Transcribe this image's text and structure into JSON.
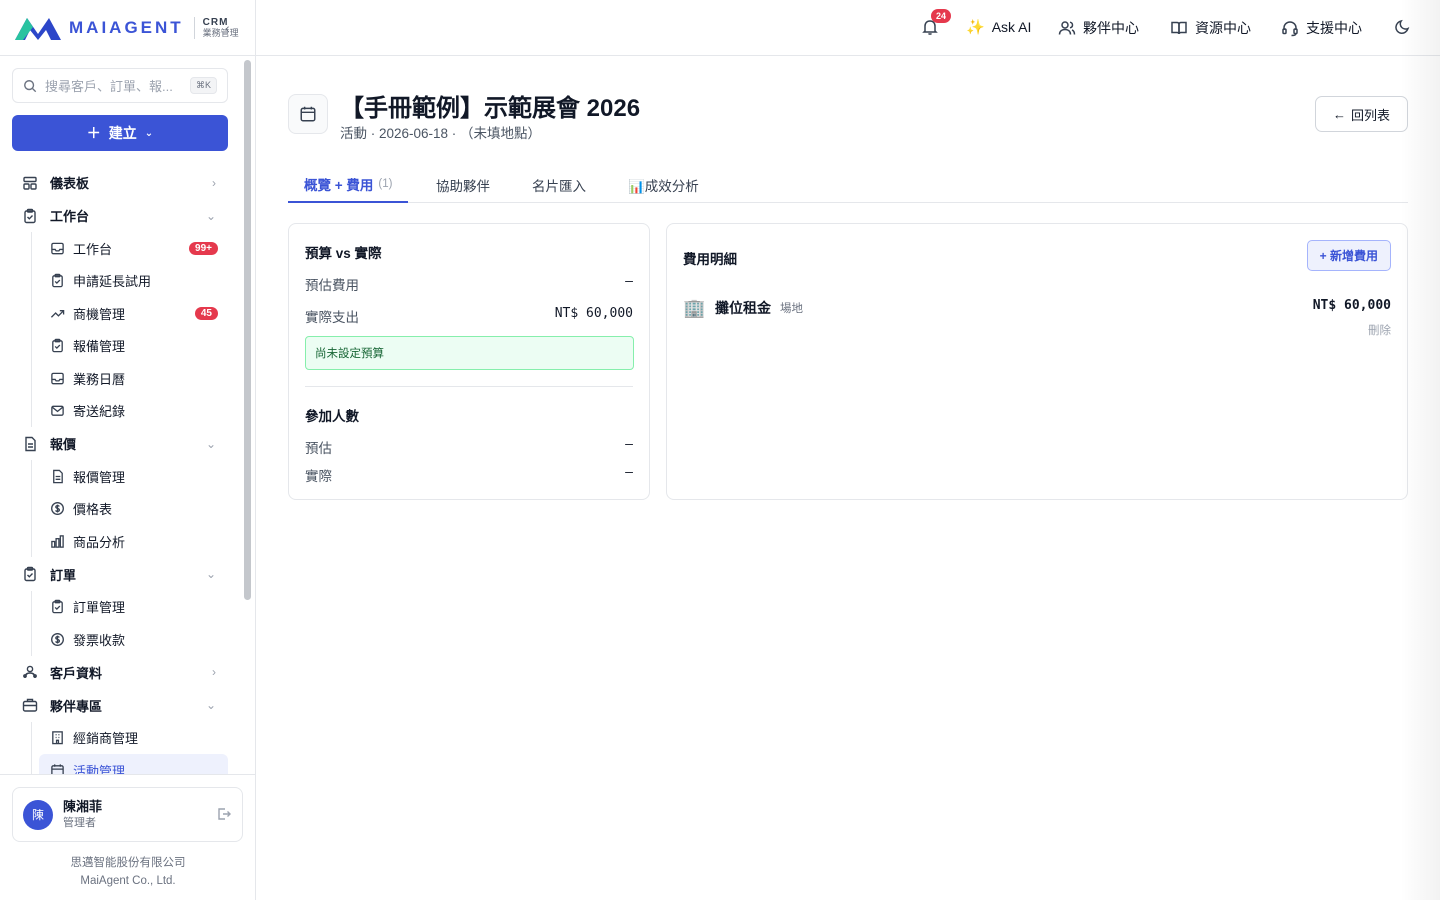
{
  "brand": {
    "name": "MAIAGENT",
    "crm_line1": "CRM",
    "crm_line2": "業務管理"
  },
  "search": {
    "placeholder": "搜尋客戶、訂單、報...",
    "shortcut": "⌘K"
  },
  "create_label": "建立",
  "nav": {
    "dashboard": "儀表板",
    "workbench": "工作台",
    "workbench_items": [
      {
        "label": "工作台",
        "badge": "99+"
      },
      {
        "label": "申請延長試用"
      },
      {
        "label": "商機管理",
        "badge": "45"
      },
      {
        "label": "報備管理"
      },
      {
        "label": "業務日曆"
      },
      {
        "label": "寄送紀錄"
      }
    ],
    "quote": "報價",
    "quote_items": [
      {
        "label": "報價管理"
      },
      {
        "label": "價格表"
      },
      {
        "label": "商品分析"
      }
    ],
    "order": "訂單",
    "order_items": [
      {
        "label": "訂單管理"
      },
      {
        "label": "發票收款"
      }
    ],
    "customer": "客戶資料",
    "partner": "夥伴專區",
    "partner_items": [
      {
        "label": "經銷商管理"
      },
      {
        "label": "活動管理"
      }
    ]
  },
  "user": {
    "avatar": "陳",
    "name": "陳湘菲",
    "role": "管理者"
  },
  "company": {
    "zh": "思邁智能股份有限公司",
    "en": "MaiAgent Co., Ltd."
  },
  "topbar": {
    "notif_count": "24",
    "ask_ai": "Ask AI",
    "partner_center": "夥伴中心",
    "resource_center": "資源中心",
    "support_center": "支援中心"
  },
  "page": {
    "title": "【手冊範例】示範展會 2026",
    "subtitle": "活動 · 2026-06-18 · （未填地點）",
    "back_label": "回列表"
  },
  "tabs": [
    {
      "label": "概覽 + 費用",
      "count": "(1)"
    },
    {
      "label": "協助夥伴"
    },
    {
      "label": "名片匯入"
    },
    {
      "label": "📊成效分析"
    }
  ],
  "budget": {
    "title": "預算 vs 實際",
    "est_label": "預估費用",
    "est_value": "–",
    "actual_label": "實際支出",
    "actual_value": "NT$ 60,000",
    "notice": "尚未設定預算"
  },
  "attendees": {
    "title": "參加人數",
    "est_label": "預估",
    "est_value": "–",
    "actual_label": "實際",
    "actual_value": "–"
  },
  "expenses": {
    "title": "費用明細",
    "add_label": "+ 新增費用",
    "items": [
      {
        "icon": "🏢",
        "name": "攤位租金",
        "category": "場地",
        "amount": "NT$ 60,000",
        "delete": "刪除"
      }
    ]
  },
  "colors": {
    "accent": "#3b54d6",
    "badge": "#e5394d",
    "notice_bg": "#ecfdf3"
  }
}
